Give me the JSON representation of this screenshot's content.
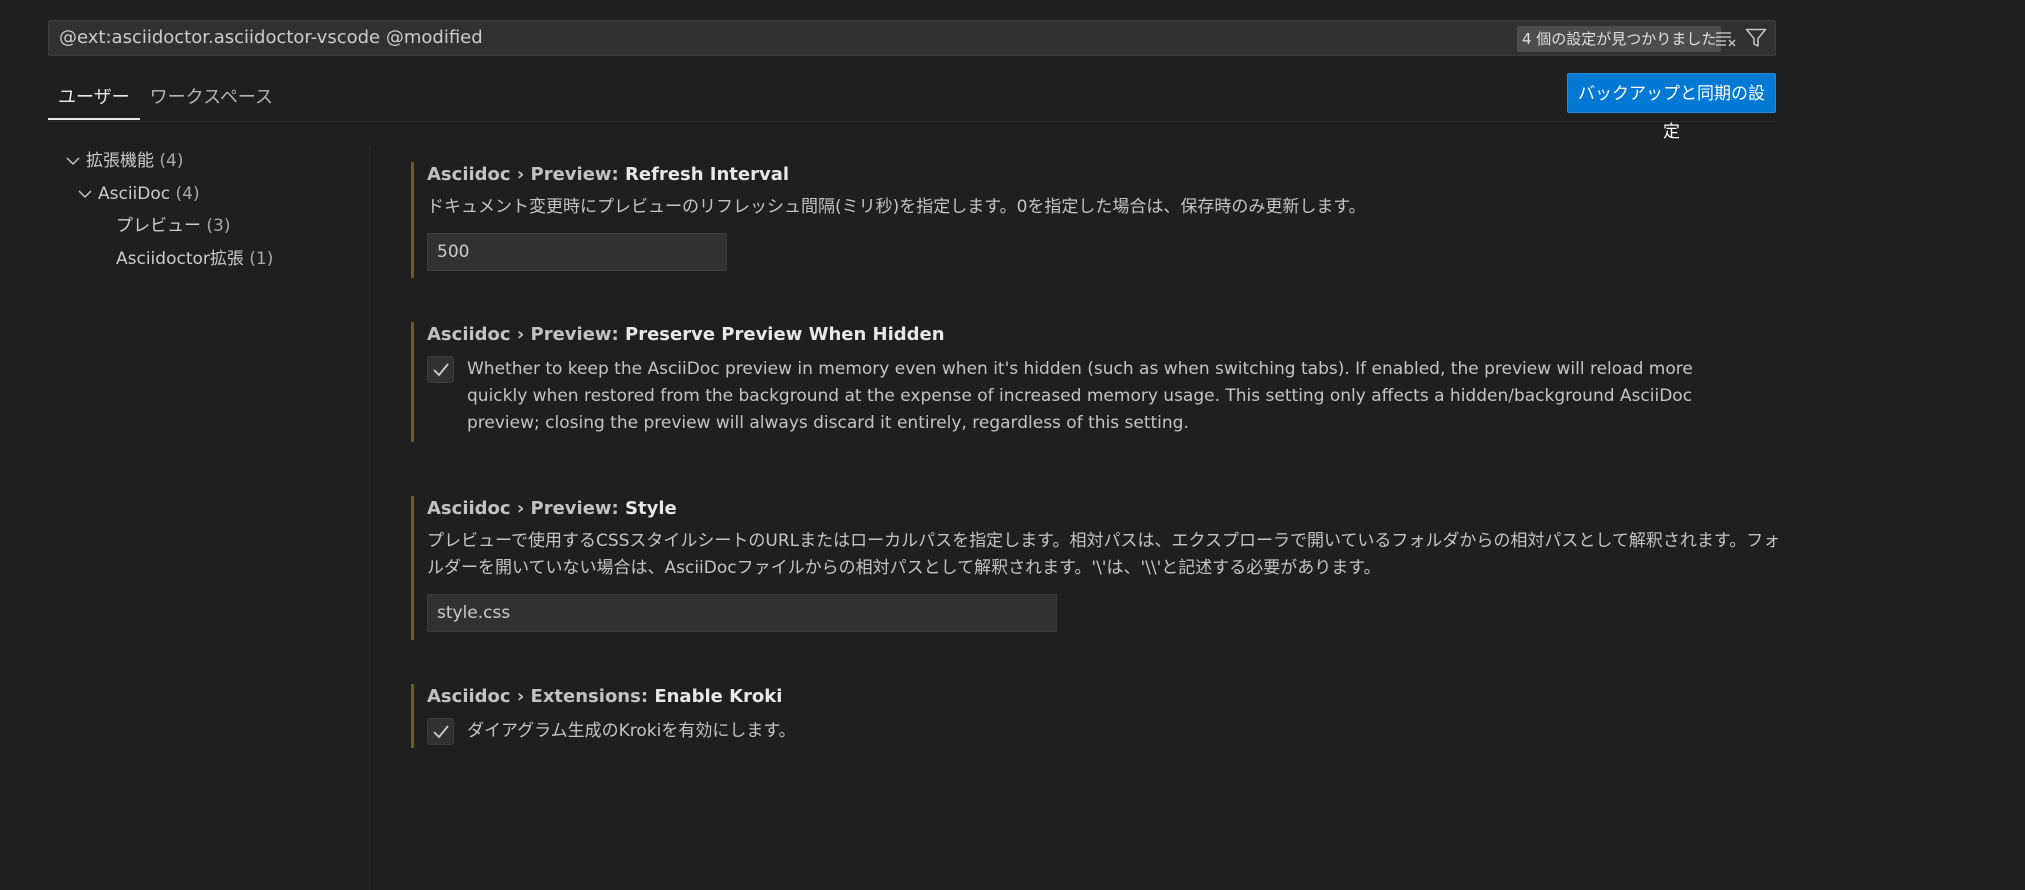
{
  "search": {
    "value": "@ext:asciidoctor.asciidoctor-vscode @modified",
    "result_count": "4 個の設定が見つかりました",
    "clear_icon": "clear-filter-icon",
    "filter_icon": "filter-icon"
  },
  "tabs": [
    {
      "label": "ユーザー",
      "active": true
    },
    {
      "label": "ワークスペース",
      "active": false
    }
  ],
  "sync_button": "バックアップと同期の設定",
  "toc": [
    {
      "label": "拡張機能",
      "count": "(4)",
      "expanded": true
    },
    {
      "label": "AsciiDoc",
      "count": "(4)",
      "expanded": true
    },
    {
      "label": "プレビュー",
      "count": "(3)"
    },
    {
      "label": "Asciidoctor拡張",
      "count": "(1)"
    }
  ],
  "settings": [
    {
      "category": "Asciidoc › Preview: ",
      "name": "Refresh Interval",
      "description": "ドキュメント変更時にプレビューのリフレッシュ間隔(ミリ秒)を指定します。0を指定した場合は、保存時のみ更新します。",
      "value": "500"
    },
    {
      "category": "Asciidoc › Preview: ",
      "name": "Preserve Preview When Hidden",
      "description": "Whether to keep the AsciiDoc preview in memory even when it's hidden (such as when switching tabs). If enabled, the preview will reload more quickly when restored from the background at the expense of increased memory usage. This setting only affects a hidden/background AsciiDoc preview; closing the preview will always discard it entirely, regardless of this setting.",
      "checked": true
    },
    {
      "category": "Asciidoc › Preview: ",
      "name": "Style",
      "description": "プレビューで使用するCSSスタイルシートのURLまたはローカルパスを指定します。相対パスは、エクスプローラで開いているフォルダからの相対パスとして解釈されます。フォルダーを開いていない場合は、AsciiDocファイルからの相対パスとして解釈されます。'\\'は、'\\\\'と記述する必要があります。",
      "value": "style.css"
    },
    {
      "category": "Asciidoc › Extensions: ",
      "name": "Enable Kroki",
      "description": "ダイアグラム生成のKrokiを有効にします。",
      "checked": true
    }
  ],
  "colors": {
    "background": "#1f1f1f",
    "accent_button": "#0078d4",
    "modified_indicator": "#74591b"
  }
}
